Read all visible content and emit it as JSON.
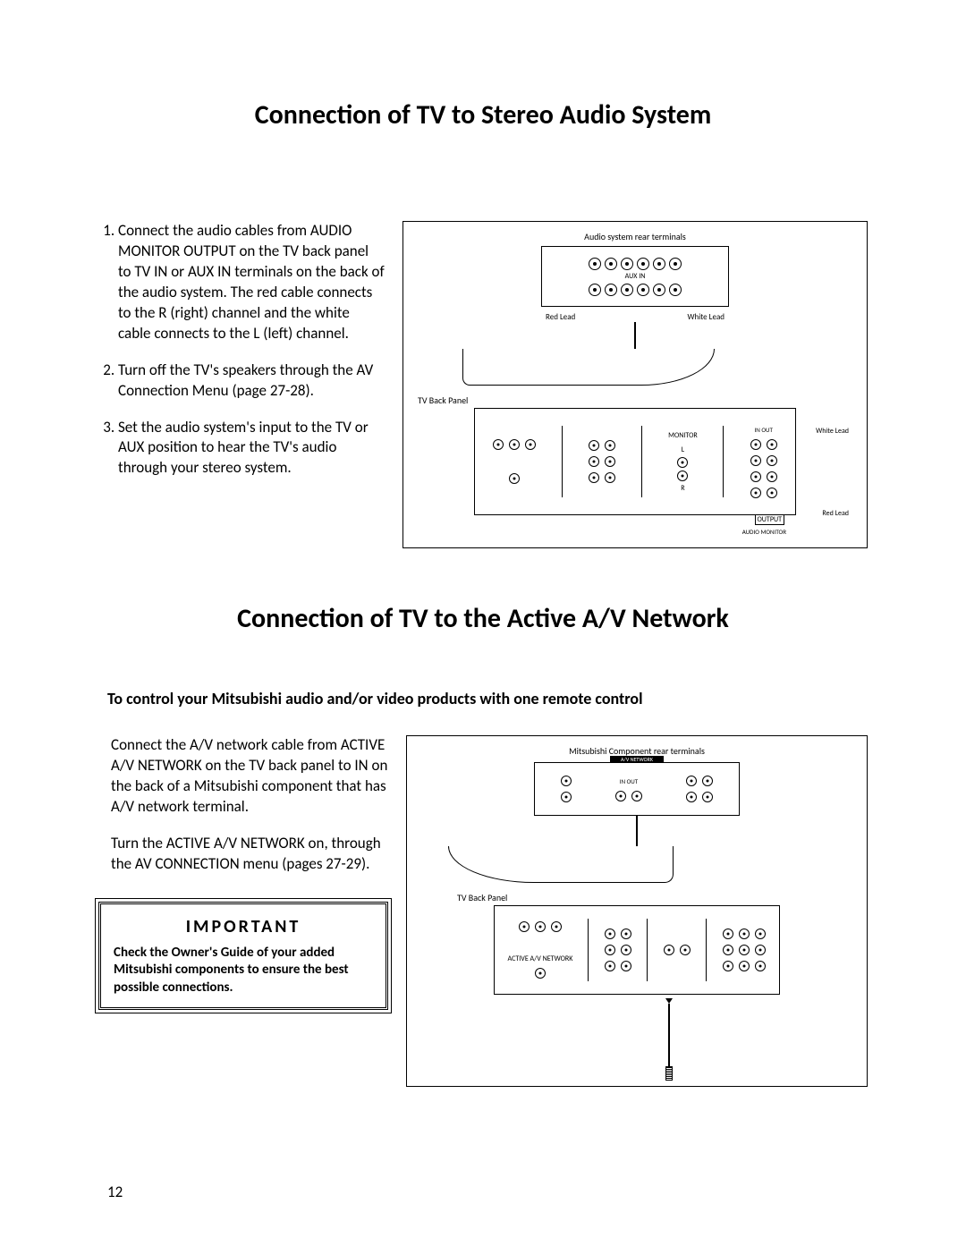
{
  "headings": {
    "h1": "Connection of TV to Stereo Audio System",
    "h2": "Connection of TV to the Active A/V Network"
  },
  "section1": {
    "steps": [
      "Connect the audio cables from AUDIO MONITOR OUTPUT on the TV back panel to TV IN or AUX IN terminals on the back of the audio system. The red cable connects to the R (right) channel and the white cable connects to the L (left) channel.",
      "Turn off the TV's speakers through the AV Connection Menu (page 27-28).",
      "Set the audio system's input to the TV or AUX position to hear the TV's audio through your stereo system."
    ],
    "fig": {
      "audio_label": "Audio system rear terminals",
      "aux_in": "AUX IN",
      "red_lead": "Red Lead",
      "white_lead": "White Lead",
      "tv_label": "TV Back Panel",
      "monitor": "MONITOR",
      "r": "R",
      "l": "L",
      "inout": "IN  OUT",
      "audio_out": "AUDIO MONITOR",
      "output": "OUTPUT"
    }
  },
  "section2": {
    "intro_bold": "To control your Mitsubishi audio and/or video products with one remote control",
    "para1": "Connect the A/V network cable from ACTIVE A/V NETWORK on the TV back panel to IN on the back of a Mitsubishi component that has A/V network terminal.",
    "para2": "Turn the ACTIVE A/V NETWORK on, through the AV CONNECTION menu (pages 27-29).",
    "important": {
      "title": "IMPORTANT",
      "text": "Check the Owner's Guide of your added Mitsubishi components to ensure the best possible connections."
    },
    "fig": {
      "comp_label": "Mitsubishi Component rear terminals",
      "av_network": "A/V NETWORK",
      "in_out": "IN   OUT",
      "tv_label": "TV Back Panel",
      "active": "ACTIVE A/V NETWORK"
    }
  },
  "page_number": "12"
}
